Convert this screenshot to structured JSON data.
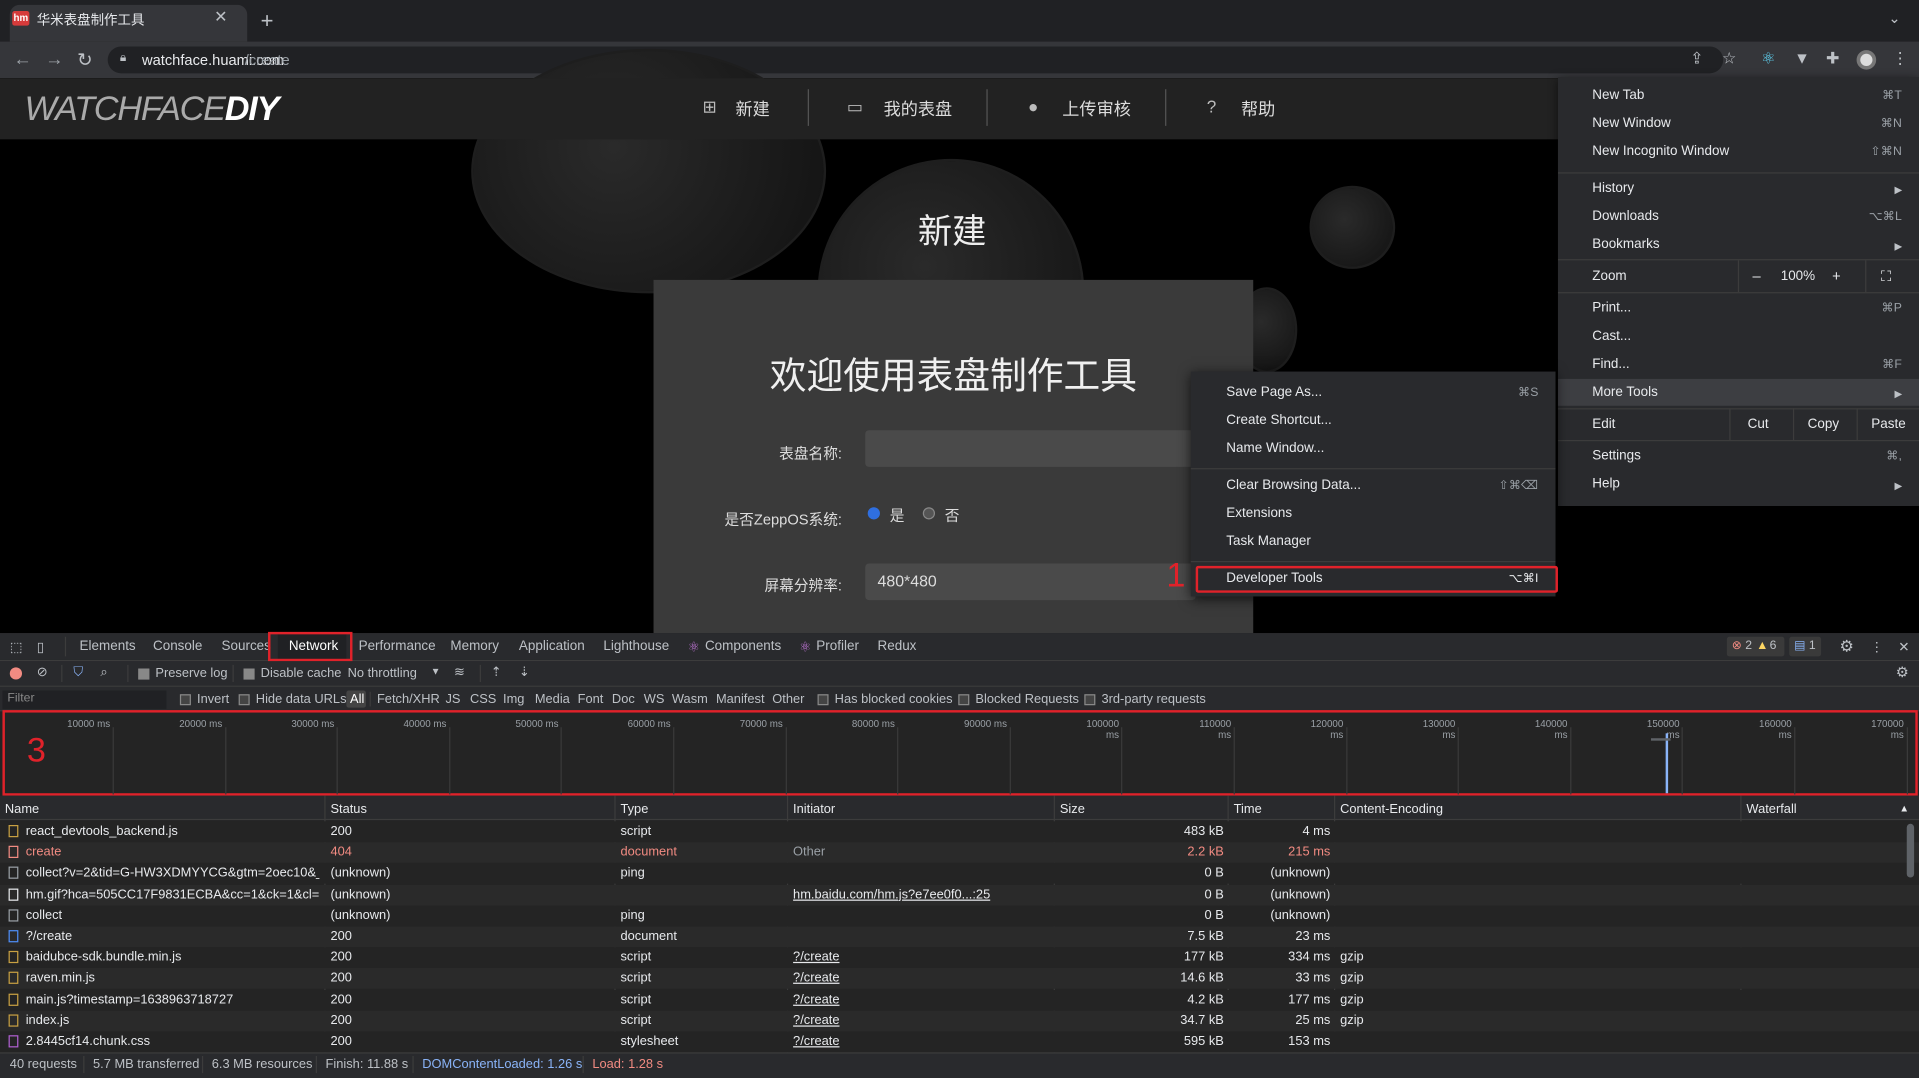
{
  "browser": {
    "tab_title": "华米表盘制作工具",
    "favicon_text": "hm",
    "url_host": "watchface.huami.com",
    "url_path": "/create"
  },
  "site": {
    "logo_light": "WATCHFACE",
    "logo_bold": "DIY",
    "nav": [
      {
        "icon": "plus-square-icon",
        "label": "新建"
      },
      {
        "icon": "folder-open-icon",
        "label": "我的表盘"
      },
      {
        "icon": "user-icon",
        "label": "上传审核"
      },
      {
        "icon": "help-circle-icon",
        "label": "帮助"
      }
    ],
    "page_heading": "新建",
    "card_title": "欢迎使用表盘制作工具",
    "form": {
      "name_label": "表盘名称:",
      "name_value": "",
      "zepp_label": "是否ZeppOS系统:",
      "zepp_yes": "是",
      "zepp_no": "否",
      "zepp_selected": "是",
      "resolution_label": "屏幕分辨率:",
      "resolution_value": "480*480"
    }
  },
  "chrome_menu": {
    "items": [
      {
        "label": "New Tab",
        "shortcut": "⌘T"
      },
      {
        "label": "New Window",
        "shortcut": "⌘N"
      },
      {
        "label": "New Incognito Window",
        "shortcut": "⇧⌘N"
      },
      {
        "label": "History",
        "shortcut": ""
      },
      {
        "label": "Downloads",
        "shortcut": "⌥⌘L"
      },
      {
        "label": "Bookmarks",
        "shortcut": ""
      },
      {
        "label": "Zoom",
        "shortcut": ""
      },
      {
        "label": "Print...",
        "shortcut": "⌘P"
      },
      {
        "label": "Cast...",
        "shortcut": ""
      },
      {
        "label": "Find...",
        "shortcut": "⌘F"
      },
      {
        "label": "More Tools",
        "shortcut": ""
      },
      {
        "label": "Edit",
        "shortcut": ""
      },
      {
        "label": "Settings",
        "shortcut": "⌘,"
      },
      {
        "label": "Help",
        "shortcut": ""
      }
    ],
    "zoom": {
      "minus": "–",
      "value": "100%",
      "plus": "+"
    },
    "edit": {
      "cut": "Cut",
      "copy": "Copy",
      "paste": "Paste"
    }
  },
  "more_tools_menu": {
    "items": [
      {
        "label": "Save Page As...",
        "shortcut": "⌘S"
      },
      {
        "label": "Create Shortcut...",
        "shortcut": ""
      },
      {
        "label": "Name Window...",
        "shortcut": ""
      },
      {
        "label": "Clear Browsing Data...",
        "shortcut": "⇧⌘⌫"
      },
      {
        "label": "Extensions",
        "shortcut": ""
      },
      {
        "label": "Task Manager",
        "shortcut": ""
      },
      {
        "label": "Developer Tools",
        "shortcut": "⌥⌘I"
      }
    ]
  },
  "annotations": {
    "step1": "1",
    "step3": "3"
  },
  "devtools": {
    "tabs": [
      "Elements",
      "Console",
      "Sources",
      "Network",
      "Performance",
      "Memory",
      "Application",
      "Lighthouse",
      "Components",
      "Profiler",
      "Redux"
    ],
    "active_tab": "Network",
    "errors": "2",
    "warnings": "6",
    "messages": "1",
    "toolbar": {
      "preserve_log": "Preserve log",
      "disable_cache": "Disable cache",
      "throttling": "No throttling"
    },
    "filter": {
      "placeholder": "Filter",
      "invert": "Invert",
      "hide_data_urls": "Hide data URLs",
      "types": [
        "All",
        "Fetch/XHR",
        "JS",
        "CSS",
        "Img",
        "Media",
        "Font",
        "Doc",
        "WS",
        "Wasm",
        "Manifest",
        "Other"
      ],
      "has_blocked_cookies": "Has blocked cookies",
      "blocked_requests": "Blocked Requests",
      "third_party": "3rd-party requests"
    },
    "timeline_ticks": [
      "10000 ms",
      "20000 ms",
      "30000 ms",
      "40000 ms",
      "50000 ms",
      "60000 ms",
      "70000 ms",
      "80000 ms",
      "90000 ms",
      "100000 ms",
      "110000 ms",
      "120000 ms",
      "130000 ms",
      "140000 ms",
      "150000 ms",
      "160000 ms",
      "170000 ms"
    ],
    "columns": [
      "Name",
      "Status",
      "Type",
      "Initiator",
      "Size",
      "Time",
      "Content-Encoding",
      "Waterfall"
    ],
    "rows": [
      {
        "name": "react_devtools_backend.js",
        "status": "200",
        "type": "script",
        "initiator": "",
        "size": "483 kB",
        "time": "4 ms",
        "enc": "",
        "error": false,
        "kind": "js"
      },
      {
        "name": "create",
        "status": "404",
        "type": "document",
        "initiator": "Other",
        "size": "2.2 kB",
        "time": "215 ms",
        "enc": "",
        "error": true,
        "kind": "doc"
      },
      {
        "name": "collect?v=2&tid=G-HW3XDMYYCG&gtm=2oec10&_...",
        "status": "(unknown)",
        "type": "ping",
        "initiator": "",
        "size": "0 B",
        "time": "(unknown)",
        "enc": "",
        "error": false,
        "kind": "other"
      },
      {
        "name": "hm.gif?hca=505CC17F9831ECBA&cc=1&ck=1&cl=2...",
        "status": "(unknown)",
        "type": "",
        "initiator": "hm.baidu.com/hm.js?e7ee0f0...:25",
        "size": "0 B",
        "time": "(unknown)",
        "enc": "",
        "error": false,
        "kind": "img"
      },
      {
        "name": "collect",
        "status": "(unknown)",
        "type": "ping",
        "initiator": "",
        "size": "0 B",
        "time": "(unknown)",
        "enc": "",
        "error": false,
        "kind": "other"
      },
      {
        "name": "?/create",
        "status": "200",
        "type": "document",
        "initiator": "",
        "size": "7.5 kB",
        "time": "23 ms",
        "enc": "",
        "error": false,
        "kind": "doc"
      },
      {
        "name": "baidubce-sdk.bundle.min.js",
        "status": "200",
        "type": "script",
        "initiator": "?/create",
        "size": "177 kB",
        "time": "334 ms",
        "enc": "gzip",
        "error": false,
        "kind": "js"
      },
      {
        "name": "raven.min.js",
        "status": "200",
        "type": "script",
        "initiator": "?/create",
        "size": "14.6 kB",
        "time": "33 ms",
        "enc": "gzip",
        "error": false,
        "kind": "js"
      },
      {
        "name": "main.js?timestamp=1638963718727",
        "status": "200",
        "type": "script",
        "initiator": "?/create",
        "size": "4.2 kB",
        "time": "177 ms",
        "enc": "gzip",
        "error": false,
        "kind": "js"
      },
      {
        "name": "index.js",
        "status": "200",
        "type": "script",
        "initiator": "?/create",
        "size": "34.7 kB",
        "time": "25 ms",
        "enc": "gzip",
        "error": false,
        "kind": "js"
      },
      {
        "name": "2.8445cf14.chunk.css",
        "status": "200",
        "type": "stylesheet",
        "initiator": "?/create",
        "size": "595 kB",
        "time": "153 ms",
        "enc": "",
        "error": false,
        "kind": "css"
      }
    ],
    "summary": {
      "requests": "40 requests",
      "transferred": "5.7 MB transferred",
      "resources": "6.3 MB resources",
      "finish": "Finish: 11.88 s",
      "dom_loaded": "DOMContentLoaded: 1.26 s",
      "load": "Load: 1.28 s"
    }
  }
}
